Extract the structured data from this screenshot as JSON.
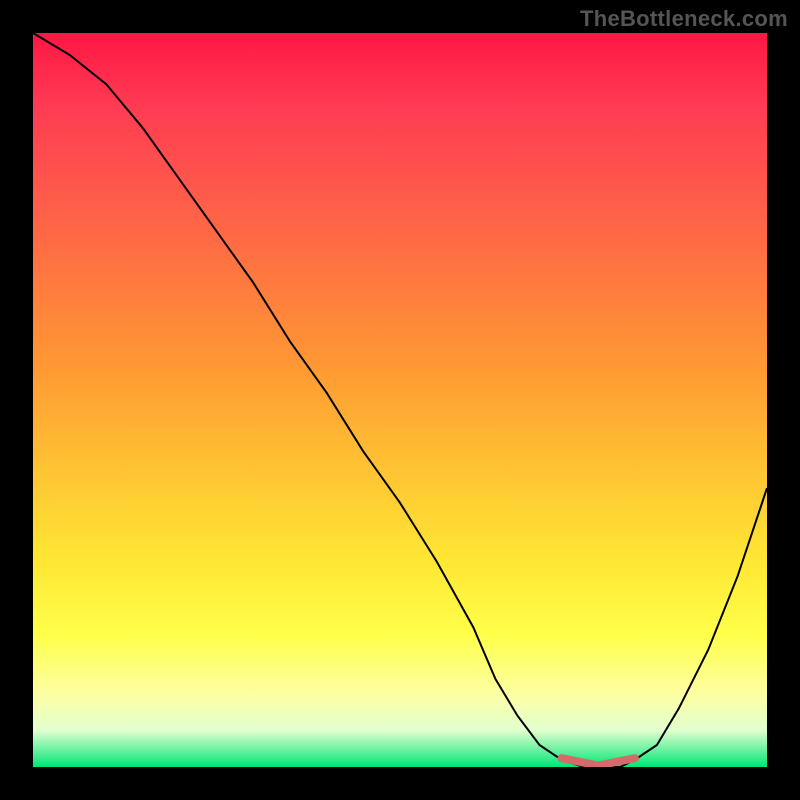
{
  "watermark": "TheBottleneck.com",
  "chart_data": {
    "type": "line",
    "title": "",
    "xlabel": "",
    "ylabel": "",
    "xlim": [
      0,
      100
    ],
    "ylim": [
      0,
      100
    ],
    "x": [
      0,
      5,
      10,
      15,
      20,
      25,
      30,
      35,
      40,
      45,
      50,
      55,
      60,
      63,
      66,
      69,
      72,
      75,
      78,
      80,
      82,
      85,
      88,
      92,
      96,
      100
    ],
    "values": [
      100,
      97,
      93,
      87,
      80,
      73,
      66,
      58,
      51,
      43,
      36,
      28,
      19,
      12,
      7,
      3,
      1,
      0,
      0,
      0,
      1,
      3,
      8,
      16,
      26,
      38
    ],
    "plateau": {
      "x_start": 72,
      "x_end": 82,
      "color": "#d46a6a"
    },
    "background_gradient_stops": [
      {
        "pos": 0,
        "color": "#ff1744"
      },
      {
        "pos": 10,
        "color": "#ff3b53"
      },
      {
        "pos": 22,
        "color": "#ff5a4a"
      },
      {
        "pos": 34,
        "color": "#ff7a3f"
      },
      {
        "pos": 46,
        "color": "#ff9a33"
      },
      {
        "pos": 60,
        "color": "#ffc533"
      },
      {
        "pos": 72,
        "color": "#ffe733"
      },
      {
        "pos": 82,
        "color": "#ffff4a"
      },
      {
        "pos": 90,
        "color": "#fdffa2"
      },
      {
        "pos": 95,
        "color": "#e2ffcf"
      },
      {
        "pos": 100,
        "color": "#00e676"
      }
    ]
  }
}
